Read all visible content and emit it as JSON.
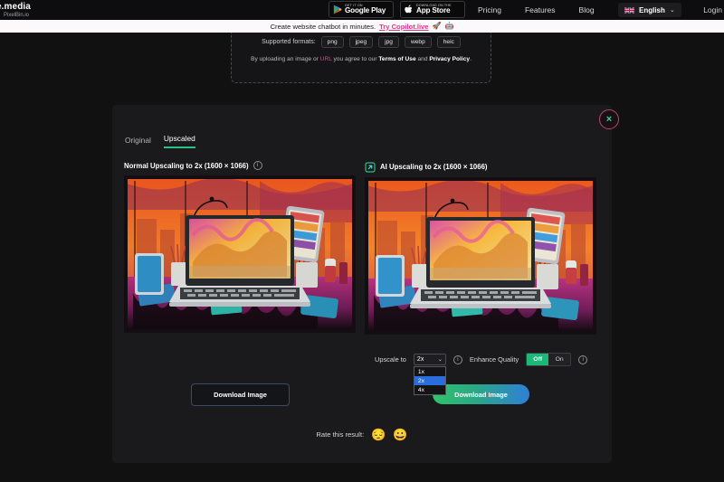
{
  "nav": {
    "brand_main": "e.media",
    "brand_sub": "PixelBin.io",
    "badges": [
      {
        "top": "GET IT ON",
        "bottom": "Google Play",
        "icon": "google-play-icon"
      },
      {
        "top": "Download on the",
        "bottom": "App Store",
        "icon": "apple-icon"
      }
    ],
    "links": [
      "Pricing",
      "Features",
      "Blog"
    ],
    "language": "English",
    "language_chevron": "⌄",
    "login": "Login"
  },
  "promo": {
    "text": "Create website chatbot in minutes.",
    "link": "Try Copilot.live",
    "emoji1": "🚀",
    "emoji2": "🤖"
  },
  "upload": {
    "formats_label": "Supported formats:",
    "formats": [
      "png",
      "jpeg",
      "jpg",
      "webp",
      "heic"
    ],
    "tos_prefix": "By uploading an image or ",
    "tos_url": "URL",
    "tos_mid": " you agree to our ",
    "tos_terms": "Terms of Use",
    "tos_and": " and ",
    "tos_privacy": "Privacy Policy",
    "tos_end": "."
  },
  "modal": {
    "close_label": "×",
    "tabs": [
      {
        "label": "Original",
        "active": false
      },
      {
        "label": "Upscaled",
        "active": true
      }
    ],
    "left_panel": {
      "title": "Normal Upscaling to 2x (1600 × 1066)",
      "info_glyph": "i",
      "download_label": "Download Image"
    },
    "right_panel": {
      "title": "AI Upscaling to 2x (1600 × 1066)",
      "icon": "ai-upscale-arrow-icon",
      "info_glyph": "i",
      "download_label": "Download Image"
    },
    "controls": {
      "upscale_label": "Upscale to",
      "upscale_value": "2x",
      "upscale_arrow": "⌄",
      "upscale_options": [
        "1x",
        "2x",
        "4x"
      ],
      "upscale_selected_index": 1,
      "enhance_label": "Enhance Quality",
      "enhance_off": "Off",
      "enhance_on": "On",
      "enhance_active": "Off",
      "info_glyph": "i"
    },
    "rate": {
      "label": "Rate this result:",
      "emoji_bad": "😔",
      "emoji_good": "😀"
    }
  },
  "colors": {
    "accent_green": "#27c281",
    "accent_pink": "#e8308a",
    "select_highlight": "#2a6ede",
    "toggle_on": "#1bb877",
    "page_bg": "#111112",
    "modal_bg": "#1a1a1c"
  }
}
